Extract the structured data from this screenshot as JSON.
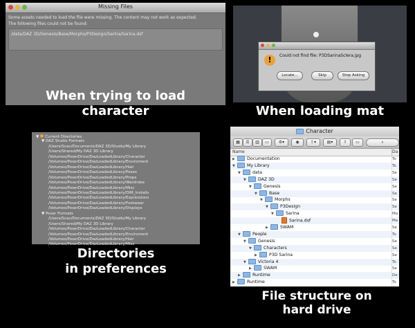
{
  "panel1": {
    "title": "Missing Files",
    "message1": "Some assets needed to load the file were missing. The content may not work as expected.",
    "message2": "The following files could not be found:",
    "missing_file": "/data/DAZ 3D/Genesis/Base/Morphs/P3Design/Sarina/Sarina.dsf",
    "caption": "When trying to load character"
  },
  "panel2": {
    "dialog_message": "Could not find file: P3DSarinaSclera.jpg",
    "buttons": [
      "Locate...",
      "Skip",
      "Stop Asking"
    ],
    "caption": "When loading mat"
  },
  "panel3": {
    "root": "Current Directories",
    "group1": "DAZ Studio Formats",
    "group1_items": [
      "/Users/Scav/Documents/DAZ 3D/Studio/My Library",
      "/Users/Shared/My DAZ 3D Library",
      "/Volumes/PoserDrive/DazLoadedLibrary/Character",
      "/Volumes/PoserDrive/DazLoadedLibrary/Enviroment",
      "/Volumes/PoserDrive/DazLoadedLibrary/Hair",
      "/Volumes/PoserDrive/DazLoadedLibrary/Poses",
      "/Volumes/PoserDrive/DazLoadedLibrary/Props",
      "/Volumes/PoserDrive/DazLoadedLibrary/Wardrobe",
      "/Volumes/PoserDrive/DazLoadedLibrary/Misc",
      "/Volumes/PoserDrive/DazLoadedLibrary/DIM_Installs",
      "/Volumes/PoserDrive/DazLoadedLibrary/Expressions",
      "/Volumes/PoserDrive/DazLoadedLibrary/Footwear",
      "/Volumes/PoserDrive/DazLoadedLibrary/Displays"
    ],
    "group2": "Poser Formats",
    "group2_items": [
      "/Users/Scav/Documents/DAZ 3D/Studio/My Library",
      "/Users/Shared/My DAZ 3D Library",
      "/Volumes/PoserDrive/DazLoadedLibrary/Character",
      "/Volumes/PoserDrive/DazLoadedLibrary/Enviroment",
      "/Volumes/PoserDrive/DazLoadedLibrary/Hair",
      "/Volumes/PoserDrive/DazLoadedLibrary/Misc"
    ],
    "caption_line1": "Directories",
    "caption_line2": "in preferences"
  },
  "panel4": {
    "window_title": "Character",
    "column_name": "Name",
    "column_date": "Da",
    "rows": [
      {
        "name": "Documentation",
        "indent": 0,
        "open": false,
        "type": "folder",
        "date": "To"
      },
      {
        "name": "My Library",
        "indent": 0,
        "open": true,
        "type": "folder",
        "date": "To"
      },
      {
        "name": "data",
        "indent": 1,
        "open": true,
        "type": "folder",
        "date": "Se"
      },
      {
        "name": "DAZ 3D",
        "indent": 2,
        "open": true,
        "type": "folder",
        "date": "Se"
      },
      {
        "name": "Genesis",
        "indent": 3,
        "open": true,
        "type": "folder",
        "date": "Se"
      },
      {
        "name": "Base",
        "indent": 4,
        "open": true,
        "type": "folder",
        "date": "Se"
      },
      {
        "name": "Morphs",
        "indent": 5,
        "open": true,
        "type": "folder",
        "date": "Se"
      },
      {
        "name": "P3Design",
        "indent": 6,
        "open": true,
        "type": "folder",
        "date": "Se"
      },
      {
        "name": "Sarina",
        "indent": 7,
        "open": true,
        "type": "folder",
        "date": "Ma"
      },
      {
        "name": "Sarina.dsf",
        "indent": 8,
        "open": null,
        "type": "file",
        "date": "Ma"
      },
      {
        "name": "SWAM",
        "indent": 6,
        "open": false,
        "type": "folder",
        "date": "Se"
      },
      {
        "name": "People",
        "indent": 1,
        "open": true,
        "type": "folder",
        "date": "To"
      },
      {
        "name": "Genesis",
        "indent": 2,
        "open": true,
        "type": "folder",
        "date": "Se"
      },
      {
        "name": "Characters",
        "indent": 3,
        "open": true,
        "type": "folder",
        "date": "Se"
      },
      {
        "name": "P3D Sarina",
        "indent": 4,
        "open": false,
        "type": "folder",
        "date": "Se"
      },
      {
        "name": "Victoria 4",
        "indent": 2,
        "open": true,
        "type": "folder",
        "date": "To"
      },
      {
        "name": "SWAM",
        "indent": 3,
        "open": false,
        "type": "folder",
        "date": "Se"
      },
      {
        "name": "Runtime",
        "indent": 1,
        "open": false,
        "type": "folder",
        "date": "De"
      },
      {
        "name": "Runtime",
        "indent": 0,
        "open": false,
        "type": "folder",
        "date": "To"
      }
    ],
    "caption_line1": "File structure on",
    "caption_line2": "hard drive"
  }
}
